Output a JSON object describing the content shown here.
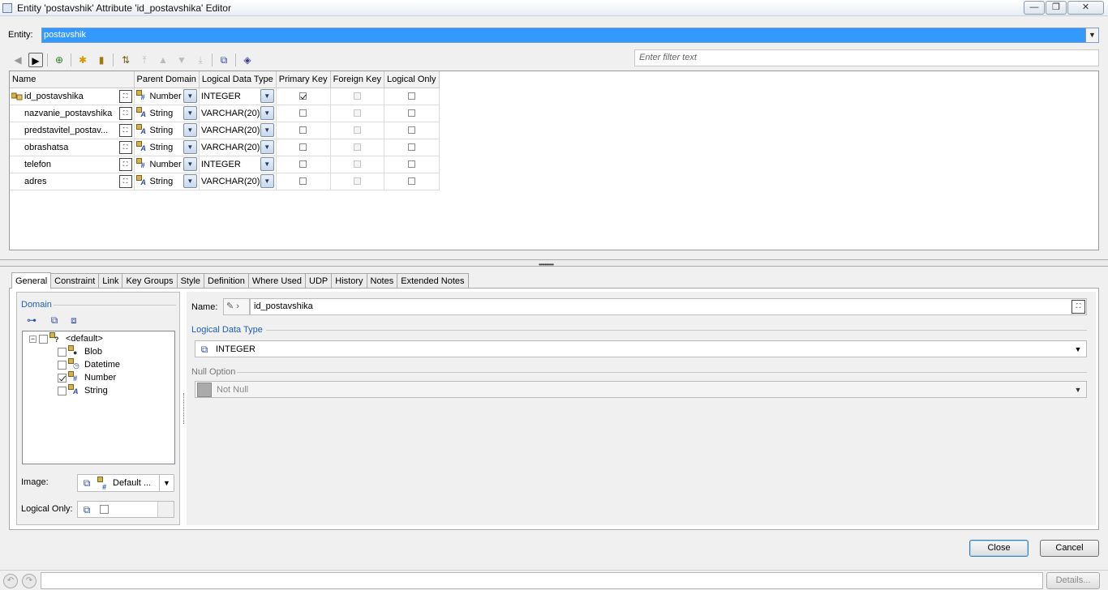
{
  "window": {
    "title": "Entity 'postavshik' Attribute 'id_postavshika' Editor",
    "minimize": "—",
    "restore": "❐",
    "close": "✕"
  },
  "entity": {
    "label": "Entity:",
    "value": "postavshik"
  },
  "toolbar": {
    "filter_placeholder": "Enter filter text"
  },
  "table": {
    "columns": [
      "Name",
      "Parent Domain",
      "Logical Data Type",
      "Primary Key",
      "Foreign Key",
      "Logical Only"
    ],
    "rows": [
      {
        "name": "id_postavshika",
        "domain": "Number",
        "type": "INTEGER",
        "pk": true,
        "fk": false,
        "lo": false
      },
      {
        "name": "nazvanie_postavshika",
        "domain": "String",
        "type": "VARCHAR(20)",
        "pk": false,
        "fk": false,
        "lo": false
      },
      {
        "name": "predstavitel_postav...",
        "domain": "String",
        "type": "VARCHAR(20)",
        "pk": false,
        "fk": false,
        "lo": false
      },
      {
        "name": "obrashatsa",
        "domain": "String",
        "type": "VARCHAR(20)",
        "pk": false,
        "fk": false,
        "lo": false
      },
      {
        "name": "telefon",
        "domain": "Number",
        "type": "INTEGER",
        "pk": false,
        "fk": false,
        "lo": false
      },
      {
        "name": "adres",
        "domain": "String",
        "type": "VARCHAR(20)",
        "pk": false,
        "fk": false,
        "lo": false
      }
    ]
  },
  "tabs": [
    "General",
    "Constraint",
    "Link",
    "Key Groups",
    "Style",
    "Definition",
    "Where Used",
    "UDP",
    "History",
    "Notes",
    "Extended Notes"
  ],
  "general": {
    "domain_label": "Domain",
    "tree": {
      "root": "<default>",
      "items": [
        {
          "label": "Blob",
          "checked": false
        },
        {
          "label": "Datetime",
          "checked": false
        },
        {
          "label": "Number",
          "checked": true
        },
        {
          "label": "String",
          "checked": false
        }
      ]
    },
    "image_label": "Image:",
    "image_value": "Default ...",
    "logical_only_label": "Logical Only:",
    "name_label": "Name:",
    "name_value": "id_postavshika",
    "logical_type_label": "Logical Data Type",
    "logical_type_value": "INTEGER",
    "null_option_label": "Null Option",
    "null_option_value": "Not Null"
  },
  "buttons": {
    "close": "Close",
    "cancel": "Cancel",
    "details": "Details..."
  },
  "colors": {
    "selection": "#3399ff",
    "section_label": "#1f5fb5"
  }
}
